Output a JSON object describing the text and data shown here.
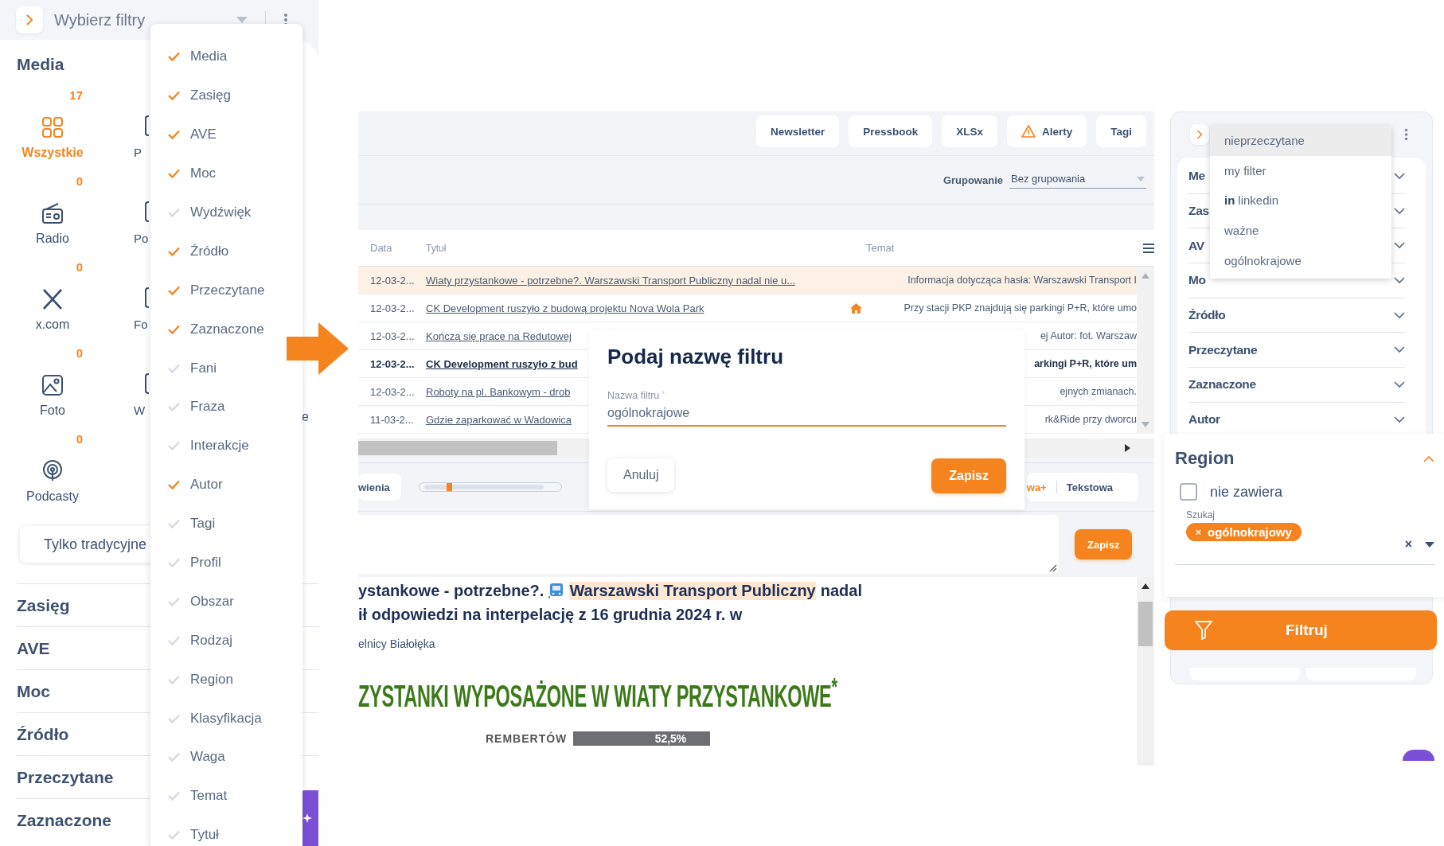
{
  "filter_panel": {
    "title": "Wybierz filtry",
    "media": {
      "heading": "Media",
      "items": [
        {
          "kind": "all",
          "label": "Wszystkie",
          "count": "17",
          "selected": true
        },
        {
          "kind": "radio",
          "label": "Radio",
          "count": "0",
          "selected": false
        },
        {
          "kind": "x",
          "label": "x.com",
          "count": "0",
          "selected": false
        },
        {
          "kind": "photo",
          "label": "Foto",
          "count": "0",
          "selected": false
        },
        {
          "kind": "podcast",
          "label": "Podcasty",
          "count": "0",
          "selected": false
        }
      ],
      "column_2": [
        "P",
        "Po",
        "Fo",
        "W"
      ],
      "column_3": "e",
      "button": "Tylko tradycyjne"
    },
    "sections": [
      "Zasięg",
      "AVE",
      "Moc",
      "Źródło",
      "Przeczytane",
      "Zaznaczone"
    ]
  },
  "filter_menu": [
    {
      "label": "Media",
      "checked": true
    },
    {
      "label": "Zasięg",
      "checked": true
    },
    {
      "label": "AVE",
      "checked": true
    },
    {
      "label": "Moc",
      "checked": true
    },
    {
      "label": "Wydźwięk",
      "checked": false
    },
    {
      "label": "Źródło",
      "checked": true
    },
    {
      "label": "Przeczytane",
      "checked": true
    },
    {
      "label": "Zaznaczone",
      "checked": true
    },
    {
      "label": "Fani",
      "checked": false
    },
    {
      "label": "Fraza",
      "checked": false
    },
    {
      "label": "Interakcje",
      "checked": false
    },
    {
      "label": "Autor",
      "checked": true
    },
    {
      "label": "Tagi",
      "checked": false
    },
    {
      "label": "Profil",
      "checked": false
    },
    {
      "label": "Obszar",
      "checked": false
    },
    {
      "label": "Rodzaj",
      "checked": false
    },
    {
      "label": "Region",
      "checked": false
    },
    {
      "label": "Klasyfikacja",
      "checked": false
    },
    {
      "label": "Waga",
      "checked": false
    },
    {
      "label": "Temat",
      "checked": false
    },
    {
      "label": "Tytuł",
      "checked": false
    }
  ],
  "main": {
    "toolbar": [
      {
        "label": "Newsletter",
        "kind": "plain"
      },
      {
        "label": "Pressbook",
        "kind": "plain"
      },
      {
        "label": "XLSx",
        "kind": "plain"
      },
      {
        "label": "Alerty",
        "kind": "alert"
      },
      {
        "label": "Tagi",
        "kind": "plain"
      }
    ],
    "grouping": {
      "label": "Grupowanie",
      "value": "Bez grupowania"
    },
    "table": {
      "columns": [
        "Data",
        "Tytuł",
        "Temat"
      ],
      "rows": [
        {
          "date": "12-03-2...",
          "title": "Wiaty przystankowe - potrzebne?. Warszawski Transport Publiczny nadal nie u...",
          "topic": "Informacja dotycząca hasła: Warszawski Transport I",
          "selected": true,
          "unread": false,
          "marked": false
        },
        {
          "date": "12-03-2...",
          "title": "CK Development ruszyło z budową projektu Nova Wola Park",
          "topic": "Przy stacji PKP znajdują się parkingi P+R, które umo",
          "selected": false,
          "unread": false,
          "marked": true
        },
        {
          "date": "12-03-2...",
          "title": "Kończą się prace na Redutowej",
          "topic": "ej Autor: fot. Warszaw",
          "selected": false,
          "unread": false,
          "marked": false
        },
        {
          "date": "12-03-2...",
          "title": "CK Development ruszyło z bud",
          "topic": "arkingi P+R, które um",
          "selected": false,
          "unread": true,
          "marked": false
        },
        {
          "date": "12-03-2...",
          "title": "Roboty na pl. Bankowym - drob",
          "topic": "ejnych zmianach.",
          "selected": false,
          "unread": false,
          "marked": false
        },
        {
          "date": "11-03-2...",
          "title": "Gdzie zaparkować w Wadowica",
          "topic": "rk&Ride przy dworcu",
          "selected": false,
          "unread": false,
          "marked": false
        }
      ]
    },
    "view_controls": {
      "button": "wienia",
      "slider": {
        "level": 0.19
      },
      "modes": [
        {
          "label": "wa+",
          "selected": true
        },
        {
          "label": "Tekstowa",
          "selected": false
        }
      ]
    },
    "note_save": "Zapisz",
    "article": {
      "line_1": {
        "before": "ystankowe - potrzebne?.",
        "highlight": "Warszawski Transport Publiczny",
        "after": "nadal"
      },
      "line_2": "ił odpowiedzi na interpelację z 16 grudnia 2024 r. w",
      "source": "elnicy Białołęka",
      "headline": "ZYSTANKI WYPOSAŻONE W WIATY PRZYSTANKOWE$^{*}$",
      "bar_label": "REMBERTÓW",
      "bar_value": "52,5%"
    }
  },
  "dialog": {
    "title": "Podaj nazwę filtru",
    "field_label": "Nazwa filtru",
    "required_mark": "*",
    "value": "ogólnokrajowe",
    "cancel": "Anuluj",
    "save": "Zapisz"
  },
  "saved_filters": {
    "menu": [
      {
        "label": "nieprzeczytane",
        "selected": true
      },
      {
        "label": "my filter",
        "selected": false
      },
      {
        "label": "linkedin",
        "selected": false,
        "prefix": "in"
      },
      {
        "label": "ważne",
        "selected": false
      },
      {
        "label": "ogólnokrajowe",
        "selected": false
      }
    ],
    "sections": [
      "Me",
      "Zas",
      "AV",
      "Mo",
      "Źródło",
      "Przeczytane",
      "Zaznaczone",
      "Autor"
    ],
    "region": {
      "title": "Region",
      "expanded": true,
      "exclude": {
        "label": "nie zawiera",
        "checked": false
      },
      "search_label": "Szukaj",
      "chips": [
        {
          "label": "ogólnokrajowy",
          "remove": "×"
        }
      ],
      "clear": "×"
    },
    "filter_button": "Filtruj"
  }
}
